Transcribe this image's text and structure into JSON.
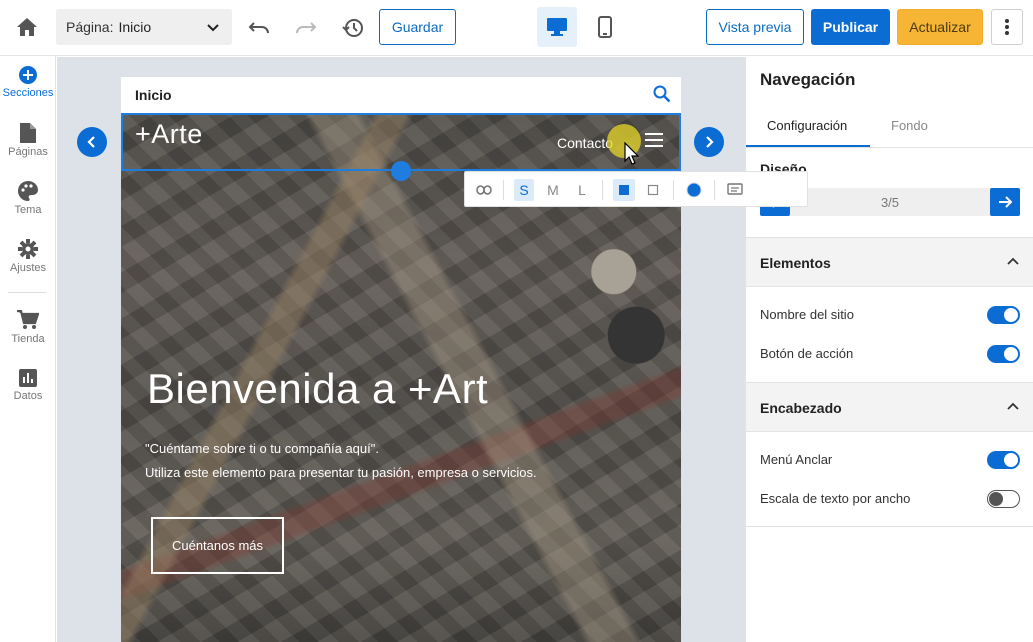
{
  "topbar": {
    "page_label": "Página:",
    "page_value": "Inicio",
    "save_label": "Guardar",
    "preview_label": "Vista previa",
    "publish_label": "Publicar",
    "update_label": "Actualizar"
  },
  "sidebar": {
    "items": [
      {
        "label": "Secciones",
        "icon": "add-circle-icon"
      },
      {
        "label": "Páginas",
        "icon": "page-icon"
      },
      {
        "label": "Tema",
        "icon": "palette-icon"
      },
      {
        "label": "Ajustes",
        "icon": "gear-icon"
      },
      {
        "label": "Tienda",
        "icon": "cart-icon"
      },
      {
        "label": "Datos",
        "icon": "chart-icon"
      }
    ]
  },
  "canvas": {
    "page_bar_title": "Inicio",
    "site_logo": "+Arte",
    "nav_contact": "Contacto",
    "hero_title": "Bienvenida a +Art",
    "hero_line1": "\"Cuéntame sobre ti o tu compañía aquí\".",
    "hero_line2": "Utiliza este elemento para presentar tu pasión, empresa o servicios.",
    "hero_button": "Cuéntanos más"
  },
  "floating_toolbar": {
    "size_s": "S",
    "size_m": "M",
    "size_l": "L"
  },
  "panel": {
    "title": "Navegación",
    "tabs": [
      "Configuración",
      "Fondo"
    ],
    "design_label": "Diseño",
    "design_value": "3/5",
    "sections": [
      {
        "title": "Elementos",
        "rows": [
          {
            "label": "Nombre del sitio",
            "on": true
          },
          {
            "label": "Botón de acción",
            "on": true
          }
        ]
      },
      {
        "title": "Encabezado",
        "rows": [
          {
            "label": "Menú Anclar",
            "on": true
          },
          {
            "label": "Escala de texto por ancho",
            "on": false
          }
        ]
      }
    ]
  },
  "colors": {
    "accent": "#0b6cd4",
    "update": "#f7b535"
  }
}
